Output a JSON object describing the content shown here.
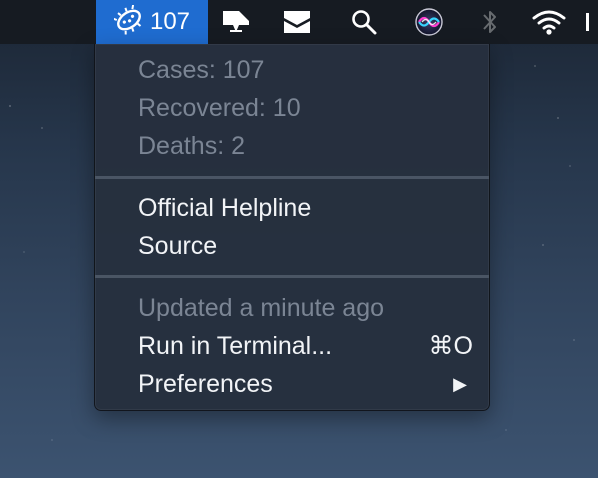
{
  "menubar": {
    "app_status": {
      "icon": "virus-icon",
      "count": "107"
    },
    "icons": [
      "notch-app-icon",
      "inbox-icon",
      "search-icon",
      "siri-icon",
      "bluetooth-icon",
      "wifi-icon"
    ]
  },
  "menu": {
    "stats": {
      "cases": "Cases: 107",
      "recovered": "Recovered: 10",
      "deaths": "Deaths: 2"
    },
    "links": {
      "helpline": "Official Helpline",
      "source": "Source"
    },
    "footer": {
      "updated": "Updated a minute ago",
      "run_in_terminal": "Run in Terminal...",
      "run_in_terminal_shortcut": "⌘O",
      "preferences": "Preferences",
      "preferences_arrow": "▶"
    }
  },
  "colors": {
    "menubar_bg": "#161b22",
    "status_highlight": "#1f6cd0",
    "menu_bg": "#26303e",
    "menu_text": "#f2f4f7",
    "menu_text_disabled": "#7b8594"
  }
}
